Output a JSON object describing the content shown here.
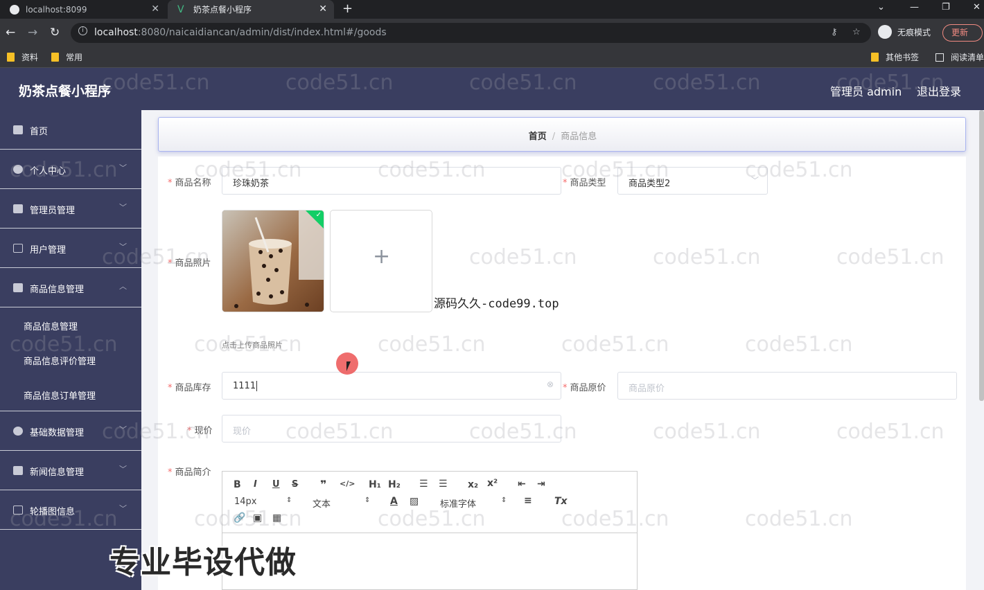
{
  "browser": {
    "tabs": [
      {
        "title": "localhost:8099"
      },
      {
        "title": "奶茶点餐小程序"
      }
    ],
    "url_host": "localhost",
    "url_rest": ":8080/naicaidiancan/admin/dist/index.html#/goods",
    "incognito_label": "无痕模式",
    "update_label": "更新",
    "bookmarks": [
      {
        "label": "资料"
      },
      {
        "label": "常用"
      },
      {
        "label": "其他书签"
      },
      {
        "label": "阅读清单"
      }
    ]
  },
  "header": {
    "title": "奶茶点餐小程序",
    "admin": "管理员 admin",
    "logout": "退出登录"
  },
  "sidebar": {
    "items": [
      {
        "label": "首页",
        "icon": "home-icon"
      },
      {
        "label": "个人中心",
        "icon": "user-icon"
      },
      {
        "label": "管理员管理",
        "icon": "clipboard-icon"
      },
      {
        "label": "用户管理",
        "icon": "id-card-icon"
      },
      {
        "label": "商品信息管理",
        "icon": "briefcase-icon"
      },
      {
        "label": "基础数据管理",
        "icon": "gauge-icon"
      },
      {
        "label": "新闻信息管理",
        "icon": "books-icon"
      },
      {
        "label": "轮播图信息",
        "icon": "message-icon"
      }
    ],
    "submenu": [
      {
        "label": "商品信息管理"
      },
      {
        "label": "商品信息评价管理"
      },
      {
        "label": "商品信息订单管理"
      }
    ]
  },
  "breadcrumb": {
    "home": "首页",
    "separator": "/",
    "current": "商品信息"
  },
  "form": {
    "name_label": "商品名称",
    "name_value": "珍珠奶茶",
    "type_label": "商品类型",
    "type_value": "商品类型2",
    "photo_label": "商品照片",
    "upload_tip": "点击上传商品照片",
    "stock_label": "商品库存",
    "stock_value": "1111",
    "original_price_label": "商品原价",
    "original_price_placeholder": "商品原价",
    "current_price_label": "现价",
    "current_price_placeholder": "现价",
    "intro_label": "商品简介",
    "required_mark": "*"
  },
  "editor": {
    "font_size": "14px",
    "format": "文本",
    "font_family": "标准字体"
  },
  "overlays": {
    "source_text": "源码久久-code99.top",
    "banner": "专业毕设代做",
    "watermark": "code51.cn"
  },
  "colors": {
    "sidebar_bg": "#3a3e60",
    "required": "#f56c6c",
    "success": "#13ce66"
  }
}
